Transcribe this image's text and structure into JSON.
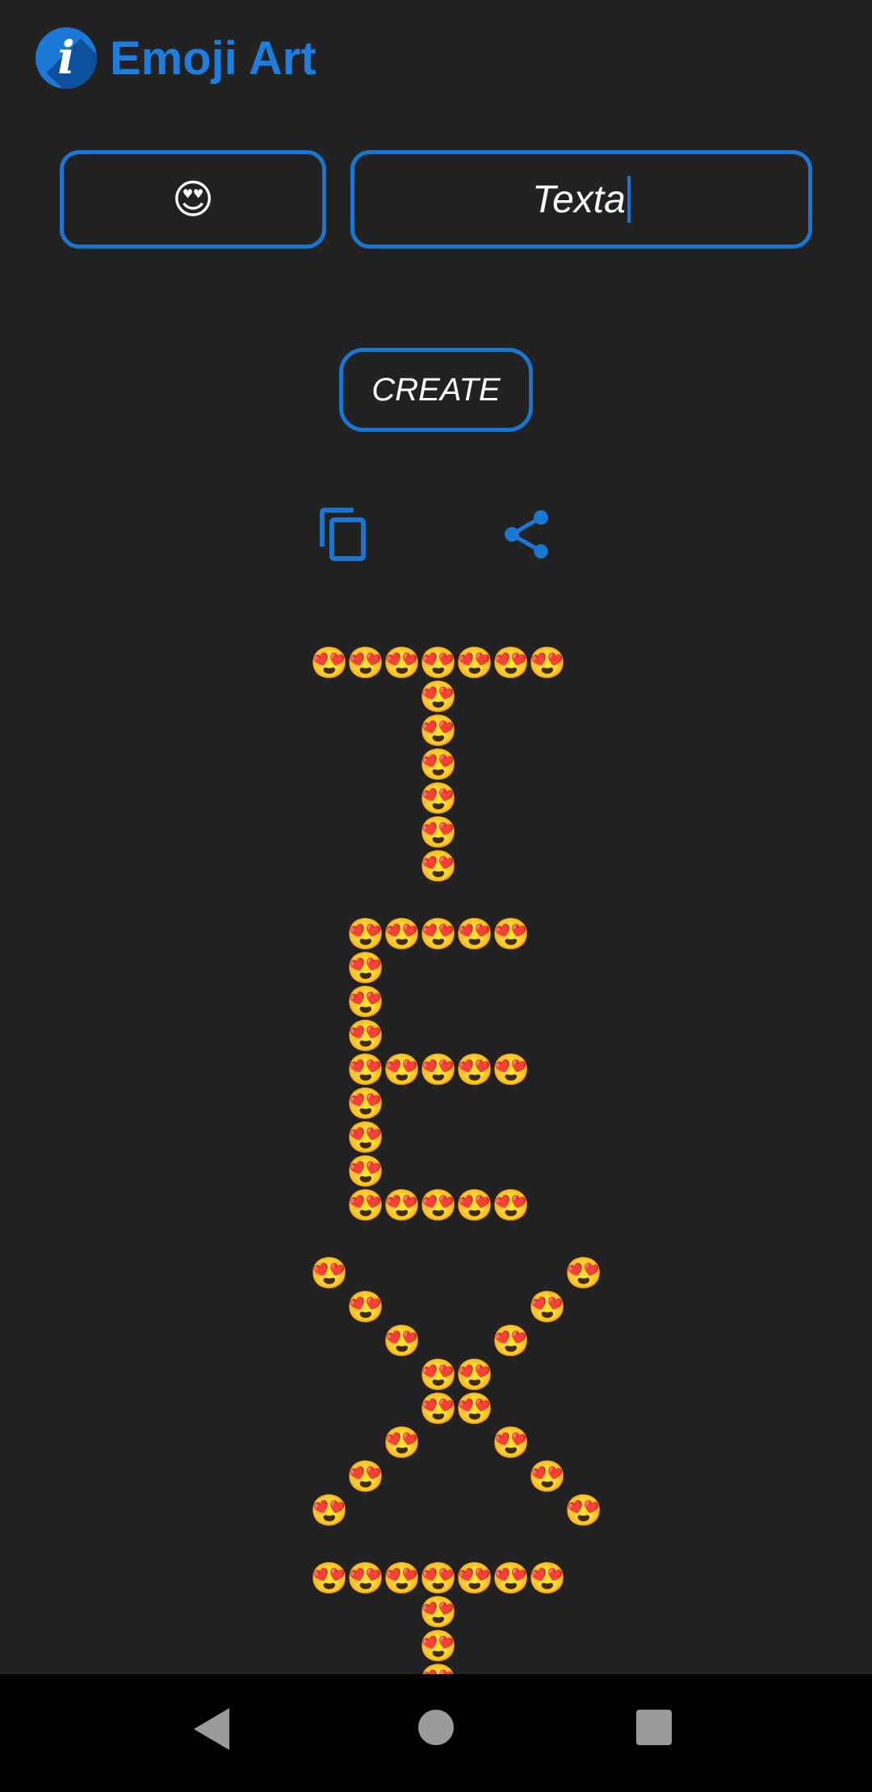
{
  "app": {
    "title": "Emoji Art"
  },
  "inputs": {
    "emoji": "😍",
    "text": "Texta"
  },
  "actions": {
    "create_label": "CREATE"
  },
  "icons": {
    "logo": "info-logo-icon",
    "copy": "copy-icon",
    "share": "share-icon"
  },
  "art": {
    "emoji": "😍",
    "columns": 8,
    "rows": [
      "XXXXXXX.",
      "...X....",
      "...X....",
      "...X....",
      "...X....",
      "...X....",
      "...X....",
      "........",
      ".XXXXX..",
      ".X......",
      ".X......",
      ".X......",
      ".XXXXX..",
      ".X......",
      ".X......",
      ".X......",
      ".XXXXX..",
      "........",
      "X......X",
      ".X....X.",
      "..X..X..",
      "...XX...",
      "...XX...",
      "..X..X..",
      ".X....X.",
      "X......X",
      "........",
      "XXXXXXX.",
      "...X....",
      "...X....",
      "...X...."
    ]
  },
  "colors": {
    "background": "#222222",
    "accent": "#1976d2",
    "title": "#1e7ee0",
    "navbar": "#000000",
    "nav_icons": "#9a9a9a"
  },
  "navigation": {
    "back": "back-icon",
    "home": "home-icon",
    "recents": "recents-icon"
  }
}
